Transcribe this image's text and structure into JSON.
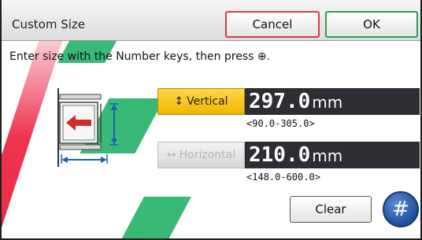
{
  "dialog": {
    "title": "Custom Size",
    "cancel_label": "Cancel",
    "ok_label": "OK",
    "instruction": "Enter size with the Number keys, then press ⊕."
  },
  "vertical": {
    "label": "Vertical",
    "arrow_glyph": "↕",
    "value": "297.0",
    "unit": "mm",
    "range": "<90.0-305.0>",
    "selected": true
  },
  "horizontal": {
    "label": "Horizontal",
    "arrow_glyph": "↔",
    "value": "210.0",
    "unit": "mm",
    "range": "<148.0-600.0>",
    "selected": false
  },
  "actions": {
    "clear_label": "Clear",
    "hash_label": "#"
  },
  "icons": {
    "paper_tray_diagram": "paper-tray-icon",
    "feed_arrow": "left-arrow-icon"
  },
  "colors": {
    "cancel_border": "#d4394a",
    "ok_border": "#2f9e4a",
    "selected_field": "#f1b600",
    "display_bg": "#2d2d33",
    "hash_button": "#1f4f9a"
  }
}
